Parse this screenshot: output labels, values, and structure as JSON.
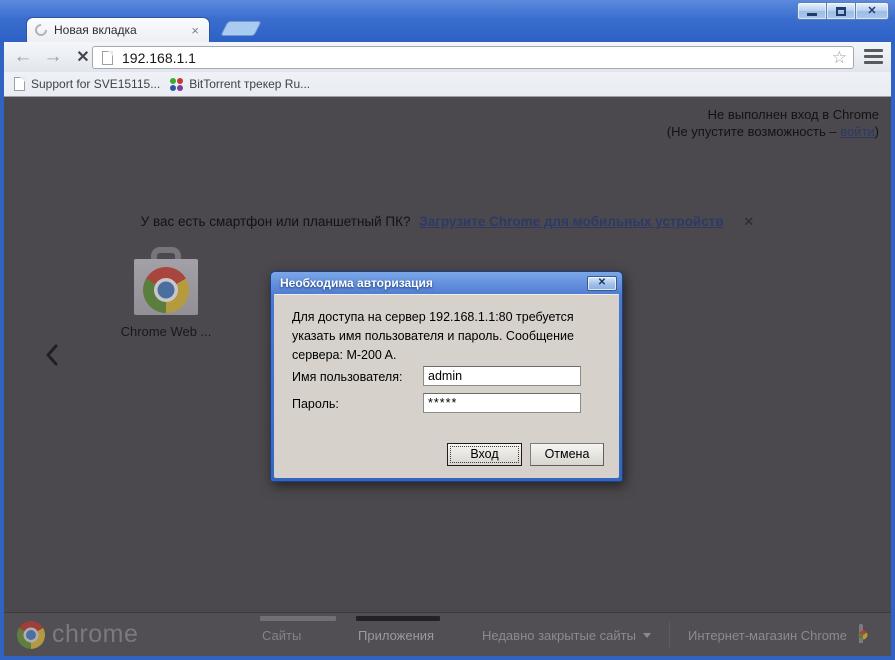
{
  "tab": {
    "title": "Новая вкладка"
  },
  "toolbar": {
    "url": "192.168.1.1"
  },
  "bookmarks": {
    "items": [
      {
        "label": "Support for SVE15115..."
      },
      {
        "label": "BitTorrent трекер Ru..."
      }
    ]
  },
  "signin": {
    "line1": "Не выполнен вход в Chrome",
    "line2_prefix": "(Не упустите возможность – ",
    "link": "войти",
    "line2_suffix": ")"
  },
  "promo": {
    "text": "У вас есть смартфон или планшетный ПК?",
    "link": "Загрузите Chrome для мобильных устройств"
  },
  "webstore": {
    "label": "Chrome Web ..."
  },
  "dialog": {
    "title": "Необходима авторизация",
    "message": "Для доступа на сервер 192.168.1.1:80 требуется указать имя пользователя и пароль. Сообщение сервера: M-200 A.",
    "username_label": "Имя пользователя:",
    "username_value": "admin",
    "password_label": "Пароль:",
    "password_value": "*****",
    "login_label": "Вход",
    "cancel_label": "Отмена"
  },
  "footer": {
    "brand": "chrome",
    "tabs": [
      {
        "label": "Сайты",
        "active": false
      },
      {
        "label": "Приложения",
        "active": true
      }
    ],
    "recently_closed": "Недавно закрытые сайты",
    "webstore_link": "Интернет-магазин Chrome"
  },
  "icons": {
    "back": "←",
    "forward": "→",
    "stop": "✕",
    "star": "☆",
    "tab_close": "×",
    "caption_close": "✕",
    "promo_close": "✕",
    "dialog_close": "✕"
  },
  "colors": {
    "titlebar-top": "#5c8bdd",
    "titlebar-bot": "#2e61c5",
    "frame-blue": "#3164c2",
    "dim-bg": "#4b494d",
    "footer-bg": "#514f53",
    "dim-text": "#121215",
    "dim-link": "#2d3a66",
    "dialog-frame1": "#7ba6e8",
    "dialog-frame2": "#3566bd",
    "dialog-body": "#d6d2cb"
  }
}
